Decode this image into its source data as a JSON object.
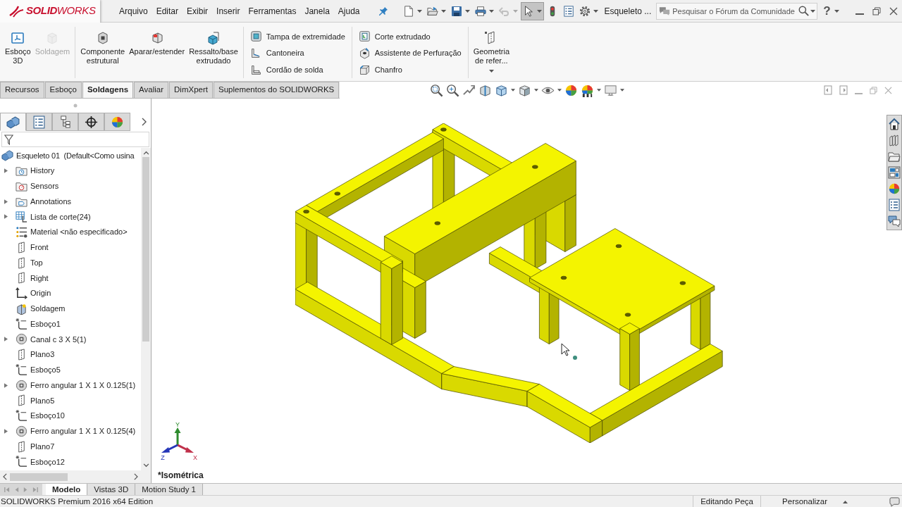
{
  "title_bar": {
    "logo": "**SOLID**WORKS",
    "menu": [
      "Arquivo",
      "Editar",
      "Exibir",
      "Inserir",
      "Ferramentas",
      "Janela",
      "Ajuda"
    ],
    "quick_access": [
      {
        "kind": "new",
        "dropdown": true,
        "disabled": false,
        "selected": false
      },
      {
        "kind": "open",
        "dropdown": true,
        "disabled": false,
        "selected": false
      },
      {
        "kind": "save",
        "dropdown": true,
        "disabled": false,
        "selected": false
      },
      {
        "kind": "print",
        "dropdown": true,
        "disabled": false,
        "selected": false
      },
      {
        "kind": "undo",
        "dropdown": true,
        "disabled": true,
        "selected": false
      },
      {
        "kind": "select",
        "dropdown": true,
        "disabled": false,
        "selected": true
      },
      {
        "kind": "rebuild",
        "dropdown": false,
        "disabled": false,
        "selected": false
      },
      {
        "kind": "properties",
        "dropdown": false,
        "disabled": false,
        "selected": false
      },
      {
        "kind": "options",
        "dropdown": true,
        "disabled": false,
        "selected": false
      }
    ],
    "document_title": "Esqueleto ...",
    "search": {
      "placeholder": "Pesquisar o Fórum da Comunidade"
    },
    "help": "?"
  },
  "ribbon": {
    "groups": [
      {
        "kind": "large",
        "buttons": [
          {
            "kind": "sketch-3d",
            "lines": [
              "Esboço",
              "3D"
            ],
            "disabled": false,
            "dropdown": false
          },
          {
            "kind": "weldment",
            "lines": [
              "Soldagem"
            ],
            "disabled": true,
            "dropdown": false
          }
        ]
      },
      {
        "kind": "large",
        "buttons": [
          {
            "kind": "structural-member",
            "lines": [
              "Componente",
              "estrutural"
            ],
            "disabled": false,
            "dropdown": false
          },
          {
            "kind": "trim-extend",
            "lines": [
              "Aparar/estender"
            ],
            "disabled": false,
            "dropdown": false
          },
          {
            "kind": "extruded-boss",
            "lines": [
              "Ressalto/base",
              "extrudado"
            ],
            "disabled": false,
            "dropdown": false
          }
        ]
      },
      {
        "kind": "small",
        "buttons": [
          {
            "kind": "end-cap",
            "label": "Tampa de extremidade",
            "disabled": false,
            "dropdown": false
          },
          {
            "kind": "gusset",
            "label": "Cantoneira",
            "disabled": false,
            "dropdown": false
          },
          {
            "kind": "fillet-bead",
            "label": "Cordão de solda",
            "disabled": false,
            "dropdown": false
          }
        ]
      },
      {
        "kind": "small",
        "buttons": [
          {
            "kind": "extruded-cut",
            "label": "Corte extrudado",
            "disabled": false,
            "dropdown": false
          },
          {
            "kind": "hole-wizard",
            "label": "Assistente de Perfuração",
            "disabled": false,
            "dropdown": false
          },
          {
            "kind": "chamfer",
            "label": "Chanfro",
            "disabled": false,
            "dropdown": false
          }
        ]
      },
      {
        "kind": "large",
        "buttons": [
          {
            "kind": "reference-geometry",
            "lines": [
              "Geometria",
              "de refer..."
            ],
            "disabled": false,
            "dropdown": true
          }
        ]
      }
    ]
  },
  "command_tabs": [
    {
      "label": "Recursos",
      "selected": false
    },
    {
      "label": "Esboço",
      "selected": false
    },
    {
      "label": "Soldagens",
      "selected": true
    },
    {
      "label": "Avaliar",
      "selected": false
    },
    {
      "label": "DimXpert",
      "selected": false
    },
    {
      "label": "Suplementos do SOLIDWORKS",
      "selected": false
    }
  ],
  "feature_manager": {
    "tabs": [
      {
        "kind": "feature-tree",
        "selected": true
      },
      {
        "kind": "property",
        "selected": false
      },
      {
        "kind": "configuration",
        "selected": false
      },
      {
        "kind": "dimxpert",
        "selected": false
      },
      {
        "kind": "display",
        "selected": false
      }
    ],
    "root": {
      "label": "Esqueleto 01  (Default<Como usina"
    },
    "items": [
      {
        "kind": "history",
        "label": "History",
        "expandable": true
      },
      {
        "kind": "sensors",
        "label": "Sensors",
        "expandable": false
      },
      {
        "kind": "annotations",
        "label": "Annotations",
        "expandable": true
      },
      {
        "kind": "cut-list",
        "label": "Lista de corte(24)",
        "expandable": true
      },
      {
        "kind": "material",
        "label": "Material <não especificado>",
        "expandable": false
      },
      {
        "kind": "plane",
        "label": "Front",
        "expandable": false
      },
      {
        "kind": "plane",
        "label": "Top",
        "expandable": false
      },
      {
        "kind": "plane",
        "label": "Right",
        "expandable": false
      },
      {
        "kind": "origin",
        "label": "Origin",
        "expandable": false
      },
      {
        "kind": "weldment",
        "label": "Soldagem",
        "expandable": false
      },
      {
        "kind": "sketch",
        "label": "Esboço1",
        "expandable": false
      },
      {
        "kind": "structural-member",
        "label": "Canal c 3 X 5(1)",
        "expandable": true
      },
      {
        "kind": "plane",
        "label": "Plano3",
        "expandable": false
      },
      {
        "kind": "sketch",
        "label": "Esboço5",
        "expandable": false
      },
      {
        "kind": "structural-member",
        "label": "Ferro angular 1 X 1 X 0.125(1)",
        "expandable": true
      },
      {
        "kind": "plane",
        "label": "Plano5",
        "expandable": false
      },
      {
        "kind": "sketch",
        "label": "Esboço10",
        "expandable": false
      },
      {
        "kind": "structural-member",
        "label": "Ferro angular 1 X 1 X 0.125(4)",
        "expandable": true
      },
      {
        "kind": "plane",
        "label": "Plano7",
        "expandable": false
      },
      {
        "kind": "sketch",
        "label": "Esboço12",
        "expandable": false
      }
    ]
  },
  "viewport": {
    "view_name": "*Isométrica",
    "triad": {
      "x": "X",
      "y": "Y",
      "z": "Z"
    }
  },
  "bottom_tabs": [
    {
      "label": "Modelo",
      "selected": true
    },
    {
      "label": "Vistas 3D",
      "selected": false
    },
    {
      "label": "Motion Study 1",
      "selected": false
    }
  ],
  "status_bar": {
    "edition": "SOLIDWORKS Premium 2016 x64 Edition",
    "mode": "Editando Peça",
    "customize": "Personalizar"
  }
}
